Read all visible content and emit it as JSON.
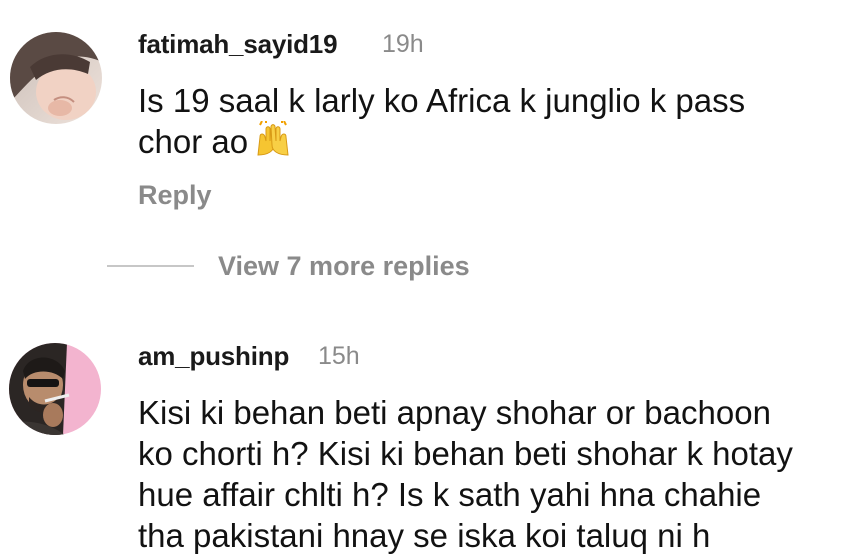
{
  "comments": [
    {
      "avatar_icon": "profile-photo-icon",
      "username": "fatimah_sayid19",
      "time": "19h",
      "text_lines": [
        "Is 19 saal k larly ko Africa k junglio k pass",
        "chor ao"
      ],
      "emoji": "raising-hands-emoji",
      "reply_label": "Reply",
      "view_replies_label": "View 7 more replies"
    },
    {
      "avatar_icon": "profile-photo-icon",
      "username": "am_pushinp",
      "time": "15h",
      "text_lines": [
        "Kisi ki behan beti apnay shohar or bachoon",
        "ko chorti h? Kisi ki behan beti shohar k hotay",
        "hue affair chlti h? Is k sath yahi hna chahie",
        "tha pakistani hnay se iska koi taluq ni h"
      ]
    }
  ],
  "colors": {
    "text": "#121212",
    "muted": "#8a8a8a",
    "divider": "#c7c7c7",
    "emoji_yellow": "#f6c531"
  }
}
